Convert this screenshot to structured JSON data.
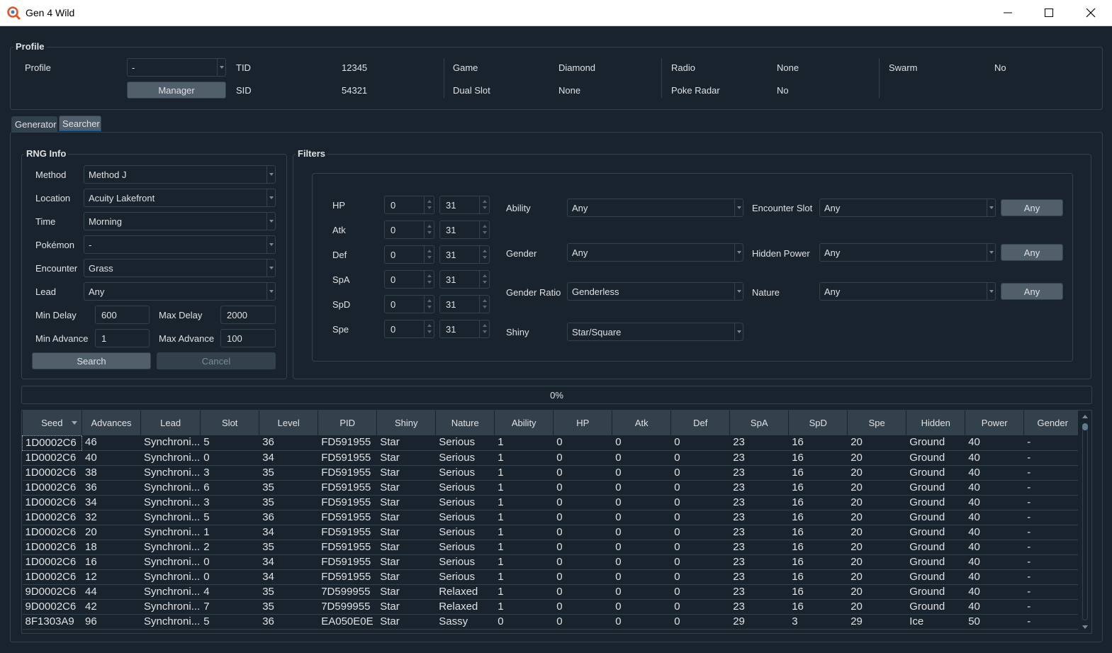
{
  "window": {
    "title": "Gen 4 Wild"
  },
  "profile": {
    "group_title": "Profile",
    "profile_label": "Profile",
    "profile_value": "-",
    "manager_button": "Manager",
    "tid_label": "TID",
    "tid_value": "12345",
    "sid_label": "SID",
    "sid_value": "54321",
    "game_label": "Game",
    "game_value": "Diamond",
    "dual_slot_label": "Dual Slot",
    "dual_slot_value": "None",
    "radio_label": "Radio",
    "radio_value": "None",
    "poke_radar_label": "Poke Radar",
    "poke_radar_value": "No",
    "swarm_label": "Swarm",
    "swarm_value": "No"
  },
  "tabs": [
    {
      "label": "Generator"
    },
    {
      "label": "Searcher"
    }
  ],
  "rng_info": {
    "group_title": "RNG Info",
    "method_label": "Method",
    "method_value": "Method J",
    "location_label": "Location",
    "location_value": "Acuity Lakefront",
    "time_label": "Time",
    "time_value": "Morning",
    "pokemon_label": "Pokémon",
    "pokemon_value": "-",
    "encounter_label": "Encounter",
    "encounter_value": "Grass",
    "lead_label": "Lead",
    "lead_value": "Any",
    "min_delay_label": "Min Delay",
    "min_delay_value": "600",
    "max_delay_label": "Max Delay",
    "max_delay_value": "2000",
    "min_advance_label": "Min Advance",
    "min_advance_value": "1",
    "max_advance_label": "Max Advance",
    "max_advance_value": "100",
    "search_button": "Search",
    "cancel_button": "Cancel"
  },
  "filters": {
    "group_title": "Filters",
    "ivs": [
      {
        "label": "HP",
        "min": "0",
        "max": "31"
      },
      {
        "label": "Atk",
        "min": "0",
        "max": "31"
      },
      {
        "label": "Def",
        "min": "0",
        "max": "31"
      },
      {
        "label": "SpA",
        "min": "0",
        "max": "31"
      },
      {
        "label": "SpD",
        "min": "0",
        "max": "31"
      },
      {
        "label": "Spe",
        "min": "0",
        "max": "31"
      }
    ],
    "ability_label": "Ability",
    "ability_value": "Any",
    "gender_label": "Gender",
    "gender_value": "Any",
    "gender_ratio_label": "Gender Ratio",
    "gender_ratio_value": "Genderless",
    "shiny_label": "Shiny",
    "shiny_value": "Star/Square",
    "encounter_slot_label": "Encounter Slot",
    "encounter_slot_value": "Any",
    "encounter_slot_any": "Any",
    "hidden_power_label": "Hidden Power",
    "hidden_power_value": "Any",
    "hidden_power_any": "Any",
    "nature_label": "Nature",
    "nature_value": "Any",
    "nature_any": "Any"
  },
  "progress": {
    "text": "0%",
    "value": 0
  },
  "results": {
    "columns": [
      "Seed",
      "Advances",
      "Lead",
      "Slot",
      "Level",
      "PID",
      "Shiny",
      "Nature",
      "Ability",
      "HP",
      "Atk",
      "Def",
      "SpA",
      "SpD",
      "Spe",
      "Hidden",
      "Power",
      "Gender"
    ],
    "rows": [
      [
        "1D0002C6",
        "46",
        "Synchroni...",
        "5",
        "36",
        "FD591955",
        "Star",
        "Serious",
        "1",
        "0",
        "0",
        "0",
        "23",
        "16",
        "20",
        "Ground",
        "40",
        "-"
      ],
      [
        "1D0002C6",
        "40",
        "Synchroni...",
        "0",
        "34",
        "FD591955",
        "Star",
        "Serious",
        "1",
        "0",
        "0",
        "0",
        "23",
        "16",
        "20",
        "Ground",
        "40",
        "-"
      ],
      [
        "1D0002C6",
        "38",
        "Synchroni...",
        "3",
        "35",
        "FD591955",
        "Star",
        "Serious",
        "1",
        "0",
        "0",
        "0",
        "23",
        "16",
        "20",
        "Ground",
        "40",
        "-"
      ],
      [
        "1D0002C6",
        "36",
        "Synchroni...",
        "6",
        "35",
        "FD591955",
        "Star",
        "Serious",
        "1",
        "0",
        "0",
        "0",
        "23",
        "16",
        "20",
        "Ground",
        "40",
        "-"
      ],
      [
        "1D0002C6",
        "34",
        "Synchroni...",
        "3",
        "35",
        "FD591955",
        "Star",
        "Serious",
        "1",
        "0",
        "0",
        "0",
        "23",
        "16",
        "20",
        "Ground",
        "40",
        "-"
      ],
      [
        "1D0002C6",
        "32",
        "Synchroni...",
        "5",
        "36",
        "FD591955",
        "Star",
        "Serious",
        "1",
        "0",
        "0",
        "0",
        "23",
        "16",
        "20",
        "Ground",
        "40",
        "-"
      ],
      [
        "1D0002C6",
        "20",
        "Synchroni...",
        "1",
        "34",
        "FD591955",
        "Star",
        "Serious",
        "1",
        "0",
        "0",
        "0",
        "23",
        "16",
        "20",
        "Ground",
        "40",
        "-"
      ],
      [
        "1D0002C6",
        "18",
        "Synchroni...",
        "2",
        "35",
        "FD591955",
        "Star",
        "Serious",
        "1",
        "0",
        "0",
        "0",
        "23",
        "16",
        "20",
        "Ground",
        "40",
        "-"
      ],
      [
        "1D0002C6",
        "16",
        "Synchroni...",
        "0",
        "34",
        "FD591955",
        "Star",
        "Serious",
        "1",
        "0",
        "0",
        "0",
        "23",
        "16",
        "20",
        "Ground",
        "40",
        "-"
      ],
      [
        "1D0002C6",
        "12",
        "Synchroni...",
        "0",
        "34",
        "FD591955",
        "Star",
        "Serious",
        "1",
        "0",
        "0",
        "0",
        "23",
        "16",
        "20",
        "Ground",
        "40",
        "-"
      ],
      [
        "9D0002C6",
        "44",
        "Synchroni...",
        "4",
        "35",
        "7D599955",
        "Star",
        "Relaxed",
        "1",
        "0",
        "0",
        "0",
        "23",
        "16",
        "20",
        "Ground",
        "40",
        "-"
      ],
      [
        "9D0002C6",
        "42",
        "Synchroni...",
        "7",
        "35",
        "7D599955",
        "Star",
        "Relaxed",
        "1",
        "0",
        "0",
        "0",
        "23",
        "16",
        "20",
        "Ground",
        "40",
        "-"
      ],
      [
        "8F1303A9",
        "96",
        "Synchroni...",
        "5",
        "36",
        "EA050E0E",
        "Star",
        "Sassy",
        "0",
        "0",
        "0",
        "0",
        "29",
        "3",
        "29",
        "Ice",
        "50",
        "-"
      ]
    ]
  }
}
